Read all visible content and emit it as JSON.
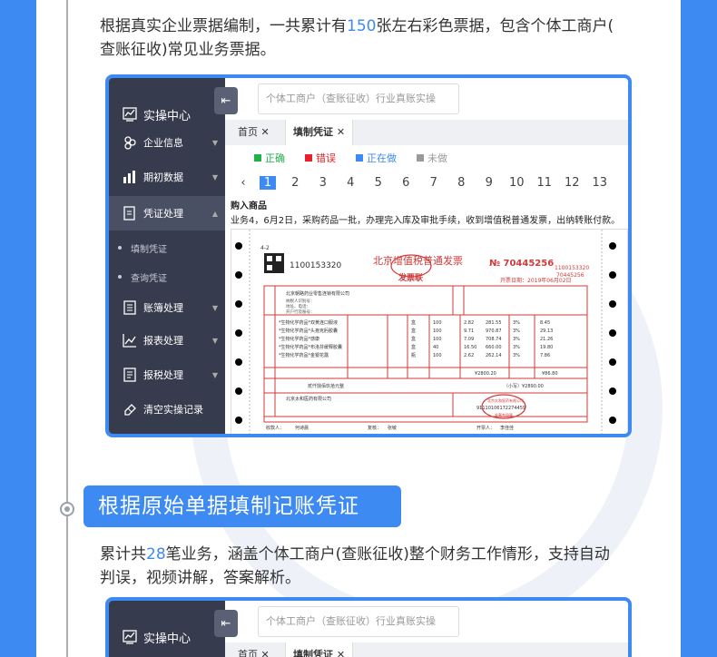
{
  "intro": {
    "line1_a": "根据真实企业票据编制，一共累计有",
    "line1_num": "150",
    "line1_b": "张左右彩色票据，包含个体工商户(",
    "line2": "查账征收)常见业务票据。"
  },
  "app": {
    "sidebar_title": "实操中心",
    "sidebar_items": [
      "企业信息",
      "期初数据",
      "凭证处理",
      "填制凭证",
      "查询凭证",
      "账簿处理",
      "报表处理",
      "报税处理",
      "清空实操记录"
    ],
    "collapse_icon": "left-arrow-icon",
    "search_placeholder": "个体工商户（查账征收）行业真账实操",
    "tabs": [
      "首页",
      "填制凭证"
    ],
    "legend": [
      {
        "label": "正确",
        "color": "#21b24b"
      },
      {
        "label": "错误",
        "color": "#e8202a"
      },
      {
        "label": "正在做",
        "color": "#3d8bf2"
      },
      {
        "label": "未做",
        "color": "#9a9a9a"
      }
    ],
    "pages": [
      "1",
      "2",
      "3",
      "4",
      "5",
      "6",
      "7",
      "8",
      "9",
      "10",
      "11",
      "12",
      "13"
    ],
    "question_title": "购入商品",
    "question_text": "业务4，6月2日，采购药品一批，办理完入库及审批手续，收到增值税普通发票，出纳转账付款。"
  },
  "invoice": {
    "code_label": "4-2",
    "code": "1100153320",
    "title": "北京增值税普通发票",
    "stamp": "发票联",
    "number": "№ 70445256",
    "number_small": "1100153320",
    "number_small2": "70445256",
    "date": "开票日期：2019年06月02日",
    "buyer_name": "北京朝路药业零售连锁有限公司",
    "total": "¥2800.20",
    "tax_total": "¥86.80",
    "grand_total": "（小写）¥2890.00",
    "amount_words": "贰仟捌佰玖拾元整",
    "seller_name": "北京太和医药有限公司",
    "payee": "收款人：",
    "reviewer": "复核：",
    "drawer": "开票人：",
    "payee_name": "何诗晨",
    "reviewer_name": "张敏",
    "drawer_name": "李佳佳",
    "seal_text": "北京太和医药有限公司",
    "seal_sub": "发票专用章",
    "seal_code": "91110106172274459",
    "items": [
      {
        "name": "*生物化学药品*双黄连口服液",
        "unit": "盒",
        "qty": "100",
        "price": "2.82",
        "amount": "281.55",
        "rate": "3%",
        "tax": "8.45"
      },
      {
        "name": "*生物化学药品*头孢克肟胶囊",
        "unit": "盒",
        "qty": "100",
        "price": "9.71",
        "amount": "970.87",
        "rate": "3%",
        "tax": "29.13"
      },
      {
        "name": "*生物化学药品*感康",
        "unit": "盒",
        "qty": "100",
        "price": "7.09",
        "amount": "708.74",
        "rate": "3%",
        "tax": "21.26"
      },
      {
        "name": "*生物化学药品*布洛芬缓释胶囊",
        "unit": "盒",
        "qty": "40",
        "price": "16.50",
        "amount": "660.00",
        "rate": "3%",
        "tax": "19.80"
      },
      {
        "name": "*生物化学药品*金银花露",
        "unit": "瓶",
        "qty": "100",
        "price": "2.62",
        "amount": "262.14",
        "rate": "3%",
        "tax": "7.86"
      }
    ]
  },
  "section": {
    "title": "根据原始单据填制记账凭证",
    "desc1_a": "累计共",
    "desc1_num": "28",
    "desc1_b": "笔业务，涵盖个体工商户(查账征收)整个财务工作情形，支持自动",
    "desc2": "判误，视频讲解，答案解析。"
  }
}
